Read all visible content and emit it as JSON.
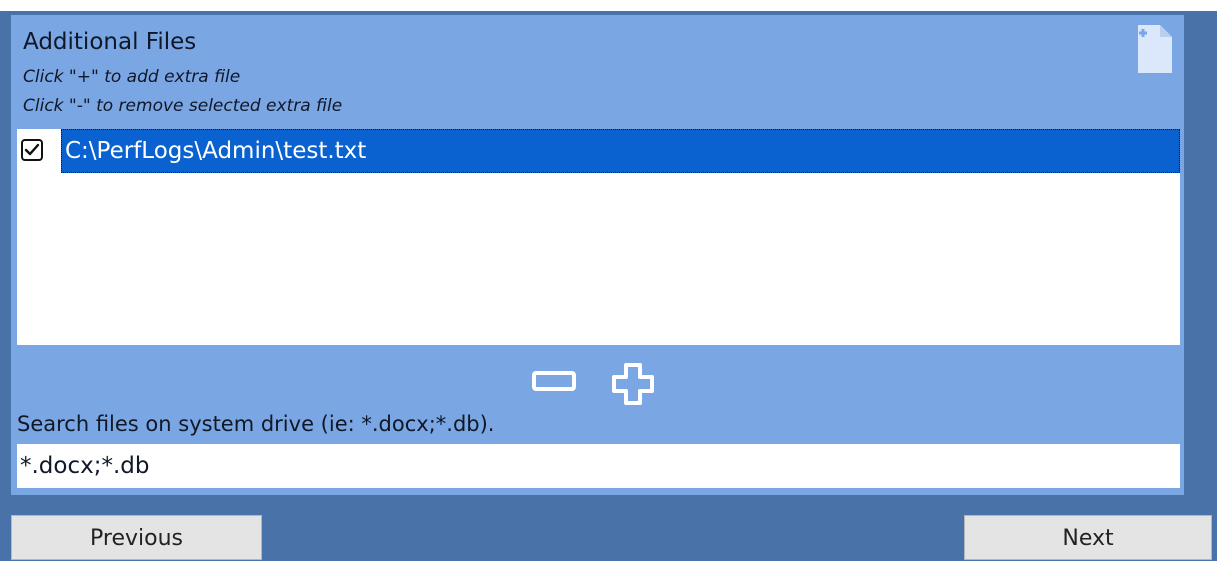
{
  "panel": {
    "title": "Additional Files",
    "hint_add": "Click \"+\" to add extra file",
    "hint_remove": "Click \"-\" to remove selected extra file",
    "file_icon": "file-add-icon"
  },
  "file_list": {
    "items": [
      {
        "label": "C:\\PerfLogs\\Admin\\test.txt",
        "checked": true,
        "selected": true
      }
    ]
  },
  "actions": {
    "remove_icon": "minus-icon",
    "add_icon": "plus-icon"
  },
  "search": {
    "label": "Search files on system drive (ie: *.docx;*.db).",
    "value": "*.docx;*.db"
  },
  "nav": {
    "previous_label": "Previous",
    "next_label": "Next"
  },
  "colors": {
    "background": "#4872a8",
    "panel": "#7aa6e4",
    "selection": "#0a62d0"
  }
}
